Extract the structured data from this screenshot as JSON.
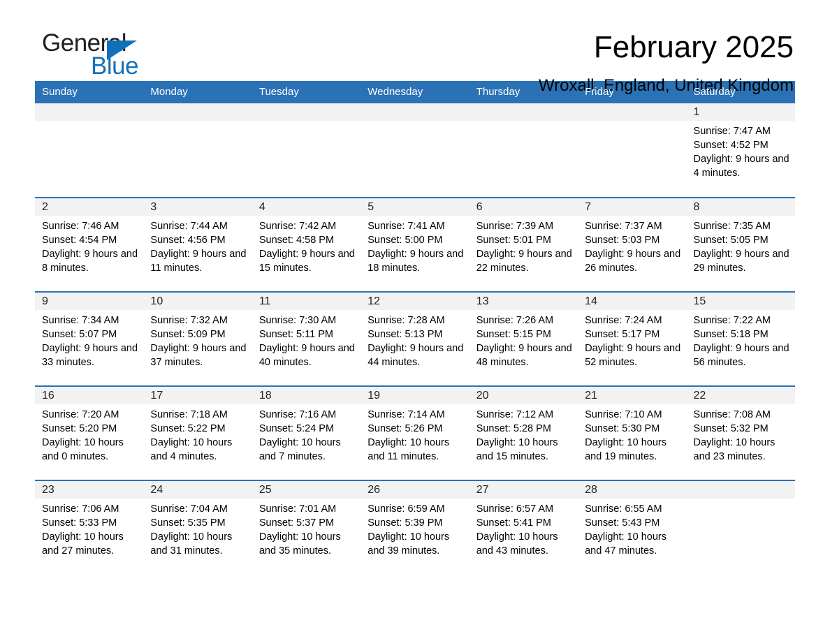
{
  "brand": {
    "name_part1": "General",
    "name_part2": "Blue",
    "accent_color": "#1270b8"
  },
  "header": {
    "title": "February 2025",
    "location": "Wroxall, England, United Kingdom"
  },
  "calendar": {
    "header_color": "#2a72b5",
    "weekday_headers": [
      "Sunday",
      "Monday",
      "Tuesday",
      "Wednesday",
      "Thursday",
      "Friday",
      "Saturday"
    ],
    "weeks": [
      [
        {
          "day": "",
          "empty": true
        },
        {
          "day": "",
          "empty": true
        },
        {
          "day": "",
          "empty": true
        },
        {
          "day": "",
          "empty": true
        },
        {
          "day": "",
          "empty": true
        },
        {
          "day": "",
          "empty": true
        },
        {
          "day": "1",
          "sunrise": "Sunrise: 7:47 AM",
          "sunset": "Sunset: 4:52 PM",
          "daylight": "Daylight: 9 hours and 4 minutes."
        }
      ],
      [
        {
          "day": "2",
          "sunrise": "Sunrise: 7:46 AM",
          "sunset": "Sunset: 4:54 PM",
          "daylight": "Daylight: 9 hours and 8 minutes."
        },
        {
          "day": "3",
          "sunrise": "Sunrise: 7:44 AM",
          "sunset": "Sunset: 4:56 PM",
          "daylight": "Daylight: 9 hours and 11 minutes."
        },
        {
          "day": "4",
          "sunrise": "Sunrise: 7:42 AM",
          "sunset": "Sunset: 4:58 PM",
          "daylight": "Daylight: 9 hours and 15 minutes."
        },
        {
          "day": "5",
          "sunrise": "Sunrise: 7:41 AM",
          "sunset": "Sunset: 5:00 PM",
          "daylight": "Daylight: 9 hours and 18 minutes."
        },
        {
          "day": "6",
          "sunrise": "Sunrise: 7:39 AM",
          "sunset": "Sunset: 5:01 PM",
          "daylight": "Daylight: 9 hours and 22 minutes."
        },
        {
          "day": "7",
          "sunrise": "Sunrise: 7:37 AM",
          "sunset": "Sunset: 5:03 PM",
          "daylight": "Daylight: 9 hours and 26 minutes."
        },
        {
          "day": "8",
          "sunrise": "Sunrise: 7:35 AM",
          "sunset": "Sunset: 5:05 PM",
          "daylight": "Daylight: 9 hours and 29 minutes."
        }
      ],
      [
        {
          "day": "9",
          "sunrise": "Sunrise: 7:34 AM",
          "sunset": "Sunset: 5:07 PM",
          "daylight": "Daylight: 9 hours and 33 minutes."
        },
        {
          "day": "10",
          "sunrise": "Sunrise: 7:32 AM",
          "sunset": "Sunset: 5:09 PM",
          "daylight": "Daylight: 9 hours and 37 minutes."
        },
        {
          "day": "11",
          "sunrise": "Sunrise: 7:30 AM",
          "sunset": "Sunset: 5:11 PM",
          "daylight": "Daylight: 9 hours and 40 minutes."
        },
        {
          "day": "12",
          "sunrise": "Sunrise: 7:28 AM",
          "sunset": "Sunset: 5:13 PM",
          "daylight": "Daylight: 9 hours and 44 minutes."
        },
        {
          "day": "13",
          "sunrise": "Sunrise: 7:26 AM",
          "sunset": "Sunset: 5:15 PM",
          "daylight": "Daylight: 9 hours and 48 minutes."
        },
        {
          "day": "14",
          "sunrise": "Sunrise: 7:24 AM",
          "sunset": "Sunset: 5:17 PM",
          "daylight": "Daylight: 9 hours and 52 minutes."
        },
        {
          "day": "15",
          "sunrise": "Sunrise: 7:22 AM",
          "sunset": "Sunset: 5:18 PM",
          "daylight": "Daylight: 9 hours and 56 minutes."
        }
      ],
      [
        {
          "day": "16",
          "sunrise": "Sunrise: 7:20 AM",
          "sunset": "Sunset: 5:20 PM",
          "daylight": "Daylight: 10 hours and 0 minutes."
        },
        {
          "day": "17",
          "sunrise": "Sunrise: 7:18 AM",
          "sunset": "Sunset: 5:22 PM",
          "daylight": "Daylight: 10 hours and 4 minutes."
        },
        {
          "day": "18",
          "sunrise": "Sunrise: 7:16 AM",
          "sunset": "Sunset: 5:24 PM",
          "daylight": "Daylight: 10 hours and 7 minutes."
        },
        {
          "day": "19",
          "sunrise": "Sunrise: 7:14 AM",
          "sunset": "Sunset: 5:26 PM",
          "daylight": "Daylight: 10 hours and 11 minutes."
        },
        {
          "day": "20",
          "sunrise": "Sunrise: 7:12 AM",
          "sunset": "Sunset: 5:28 PM",
          "daylight": "Daylight: 10 hours and 15 minutes."
        },
        {
          "day": "21",
          "sunrise": "Sunrise: 7:10 AM",
          "sunset": "Sunset: 5:30 PM",
          "daylight": "Daylight: 10 hours and 19 minutes."
        },
        {
          "day": "22",
          "sunrise": "Sunrise: 7:08 AM",
          "sunset": "Sunset: 5:32 PM",
          "daylight": "Daylight: 10 hours and 23 minutes."
        }
      ],
      [
        {
          "day": "23",
          "sunrise": "Sunrise: 7:06 AM",
          "sunset": "Sunset: 5:33 PM",
          "daylight": "Daylight: 10 hours and 27 minutes."
        },
        {
          "day": "24",
          "sunrise": "Sunrise: 7:04 AM",
          "sunset": "Sunset: 5:35 PM",
          "daylight": "Daylight: 10 hours and 31 minutes."
        },
        {
          "day": "25",
          "sunrise": "Sunrise: 7:01 AM",
          "sunset": "Sunset: 5:37 PM",
          "daylight": "Daylight: 10 hours and 35 minutes."
        },
        {
          "day": "26",
          "sunrise": "Sunrise: 6:59 AM",
          "sunset": "Sunset: 5:39 PM",
          "daylight": "Daylight: 10 hours and 39 minutes."
        },
        {
          "day": "27",
          "sunrise": "Sunrise: 6:57 AM",
          "sunset": "Sunset: 5:41 PM",
          "daylight": "Daylight: 10 hours and 43 minutes."
        },
        {
          "day": "28",
          "sunrise": "Sunrise: 6:55 AM",
          "sunset": "Sunset: 5:43 PM",
          "daylight": "Daylight: 10 hours and 47 minutes."
        },
        {
          "day": "",
          "empty": true
        }
      ]
    ]
  }
}
